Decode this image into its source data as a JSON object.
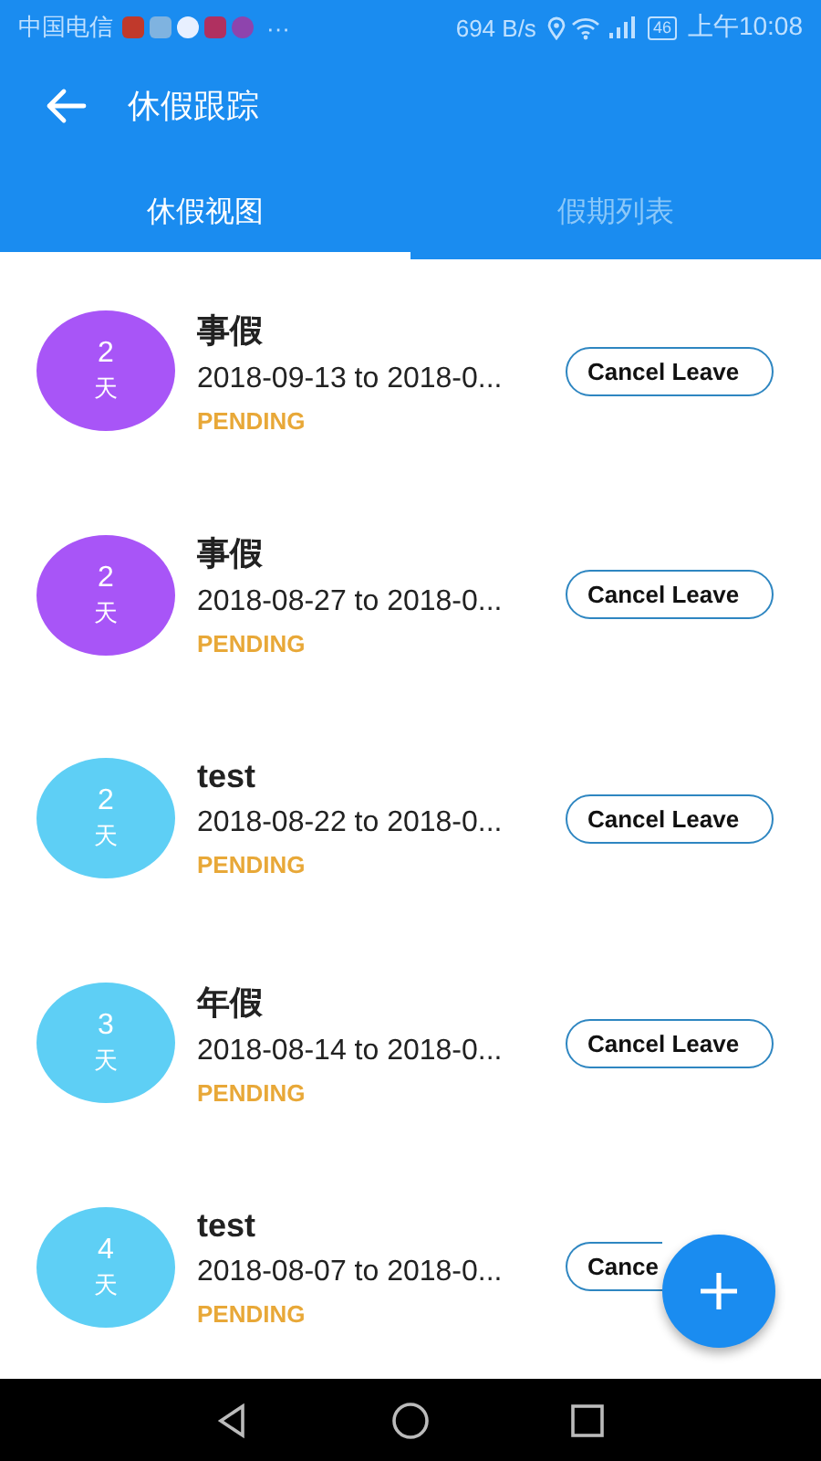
{
  "status_bar": {
    "carrier": "中国电信",
    "more": "···",
    "speed": "694 B/s",
    "battery": "46",
    "time": "上午10:08"
  },
  "app_bar": {
    "title": "休假跟踪"
  },
  "tabs": [
    {
      "label": "休假视图",
      "selected": true
    },
    {
      "label": "假期列表",
      "selected": false
    }
  ],
  "leaves": [
    {
      "days": "2",
      "unit": "天",
      "color": "#a855f7",
      "type": "事假",
      "dates": "2018-09-13 to 2018-0...",
      "status": "PENDING",
      "action": "Cancel Leave"
    },
    {
      "days": "2",
      "unit": "天",
      "color": "#a855f7",
      "type": "事假",
      "dates": "2018-08-27 to 2018-0...",
      "status": "PENDING",
      "action": "Cancel Leave"
    },
    {
      "days": "2",
      "unit": "天",
      "color": "#5ecff5",
      "type": "test",
      "dates": "2018-08-22 to 2018-0...",
      "status": "PENDING",
      "action": "Cancel Leave"
    },
    {
      "days": "3",
      "unit": "天",
      "color": "#5ecff5",
      "type": "年假",
      "dates": "2018-08-14 to 2018-0...",
      "status": "PENDING",
      "action": "Cancel Leave"
    },
    {
      "days": "4",
      "unit": "天",
      "color": "#5ecff5",
      "type": "test",
      "dates": "2018-08-07 to 2018-0...",
      "status": "PENDING",
      "action": "Cance",
      "clipped": true
    }
  ]
}
